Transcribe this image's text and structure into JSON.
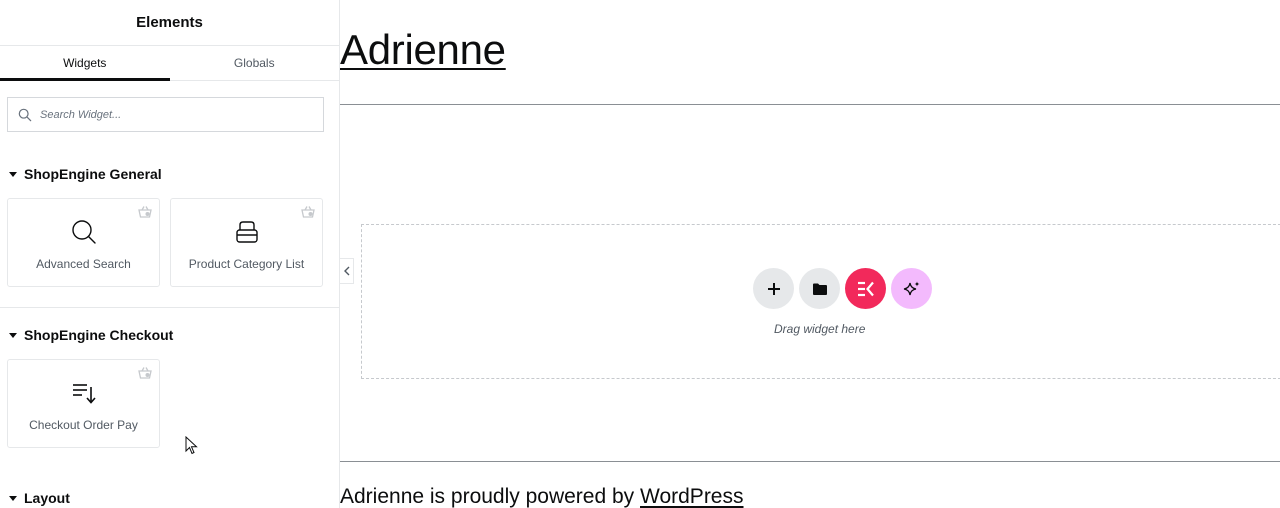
{
  "panel": {
    "title": "Elements",
    "tabs": [
      {
        "label": "Widgets",
        "active": true
      },
      {
        "label": "Globals",
        "active": false
      }
    ],
    "search": {
      "placeholder": "Search Widget..."
    },
    "categories": [
      {
        "title": "ShopEngine General",
        "widgets": [
          {
            "label": "Advanced Search",
            "icon": "magnifier-icon"
          },
          {
            "label": "Product Category List",
            "icon": "category-list-icon"
          }
        ]
      },
      {
        "title": "ShopEngine Checkout",
        "widgets": [
          {
            "label": "Checkout Order Pay",
            "icon": "order-pay-icon"
          }
        ]
      },
      {
        "title": "Layout",
        "widgets": []
      }
    ]
  },
  "canvas": {
    "site_title": "Adrienne",
    "drop_zone": {
      "text": "Drag widget here",
      "buttons": [
        {
          "name": "add-section-button",
          "icon": "plus-icon",
          "color": "#e6e8ea"
        },
        {
          "name": "template-library-button",
          "icon": "folder-icon",
          "color": "#e6e8ea"
        },
        {
          "name": "elementskit-button",
          "icon": "elementskit-icon",
          "color": "#f2295b"
        },
        {
          "name": "ai-button",
          "icon": "sparkle-icon",
          "color": "#f3bafd"
        }
      ]
    },
    "footer": {
      "text": "Adrienne is proudly powered by ",
      "link": "WordPress"
    }
  },
  "colors": {
    "accent_pink": "#f2295b",
    "ai_purple": "#f3bafd",
    "text_dark": "#0c0d0e",
    "text_muted": "#515962"
  }
}
